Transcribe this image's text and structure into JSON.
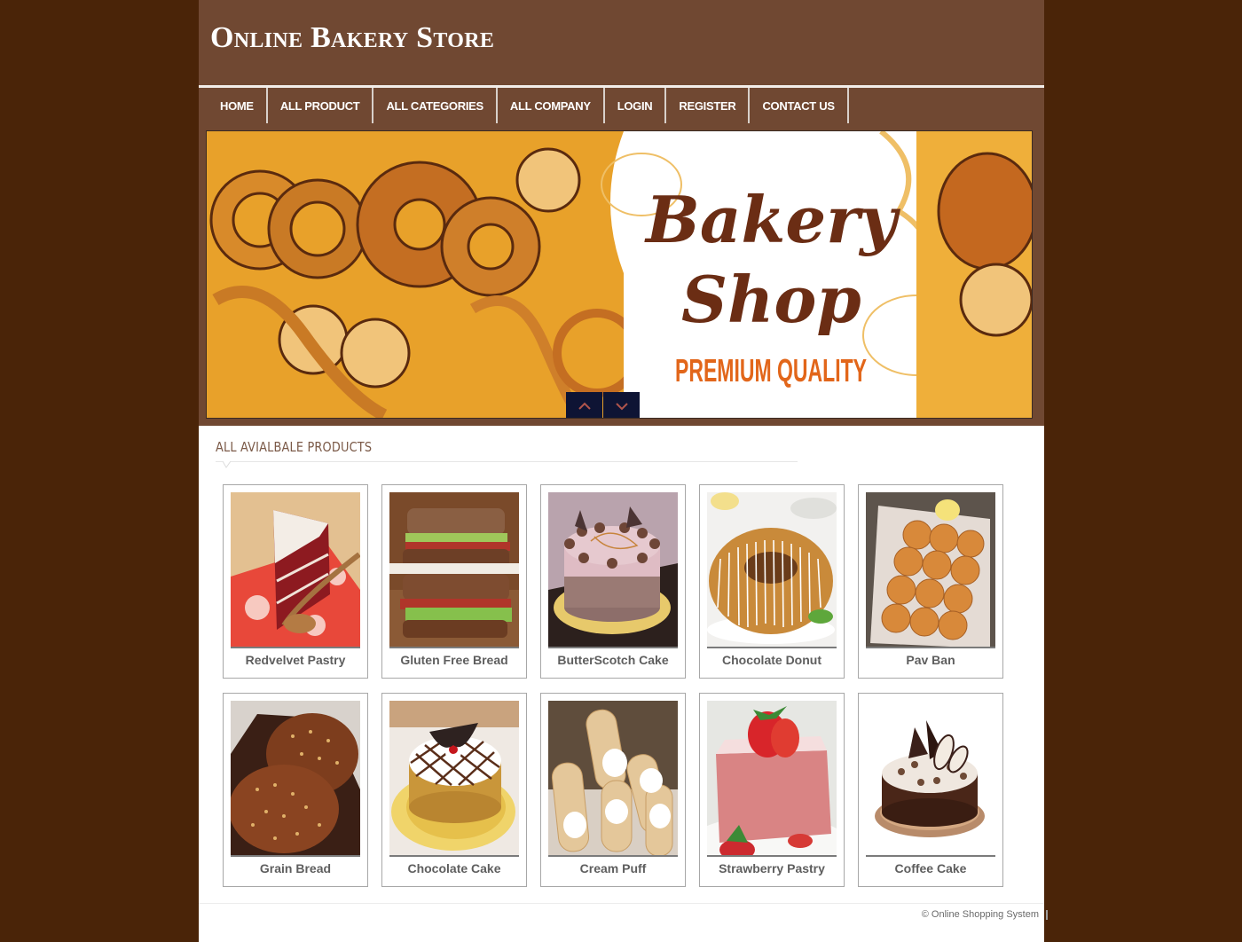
{
  "site": {
    "title": "Online Bakery Store"
  },
  "nav": {
    "items": [
      {
        "label": "HOME"
      },
      {
        "label": "ALL PRODUCT"
      },
      {
        "label": "ALL CATEGORIES"
      },
      {
        "label": "ALL COMPANY"
      },
      {
        "label": "LOGIN"
      },
      {
        "label": "REGISTER"
      },
      {
        "label": "CONTACT US"
      }
    ]
  },
  "banner": {
    "title_line1": "Bakery",
    "title_line2": "Shop",
    "tagline": "PREMIUM QUALITY",
    "prev_icon": "chevron-up-icon",
    "next_icon": "chevron-down-icon"
  },
  "products": {
    "heading": "ALL AVIALBALE PRODUCTS",
    "items": [
      {
        "name": "Redvelvet Pastry"
      },
      {
        "name": "Gluten Free Bread"
      },
      {
        "name": "ButterScotch Cake"
      },
      {
        "name": "Chocolate Donut"
      },
      {
        "name": "Pav Ban"
      },
      {
        "name": "Grain Bread"
      },
      {
        "name": "Chocolate Cake"
      },
      {
        "name": "Cream Puff"
      },
      {
        "name": "Strawberry Pastry"
      },
      {
        "name": "Coffee Cake"
      }
    ]
  },
  "footer": {
    "copyright": "© Online Shopping System"
  },
  "colors": {
    "page_bg": "#4a2408",
    "header_bg": "#704832",
    "slider_button": "#0e1434",
    "heading_text": "#7b5a48"
  }
}
